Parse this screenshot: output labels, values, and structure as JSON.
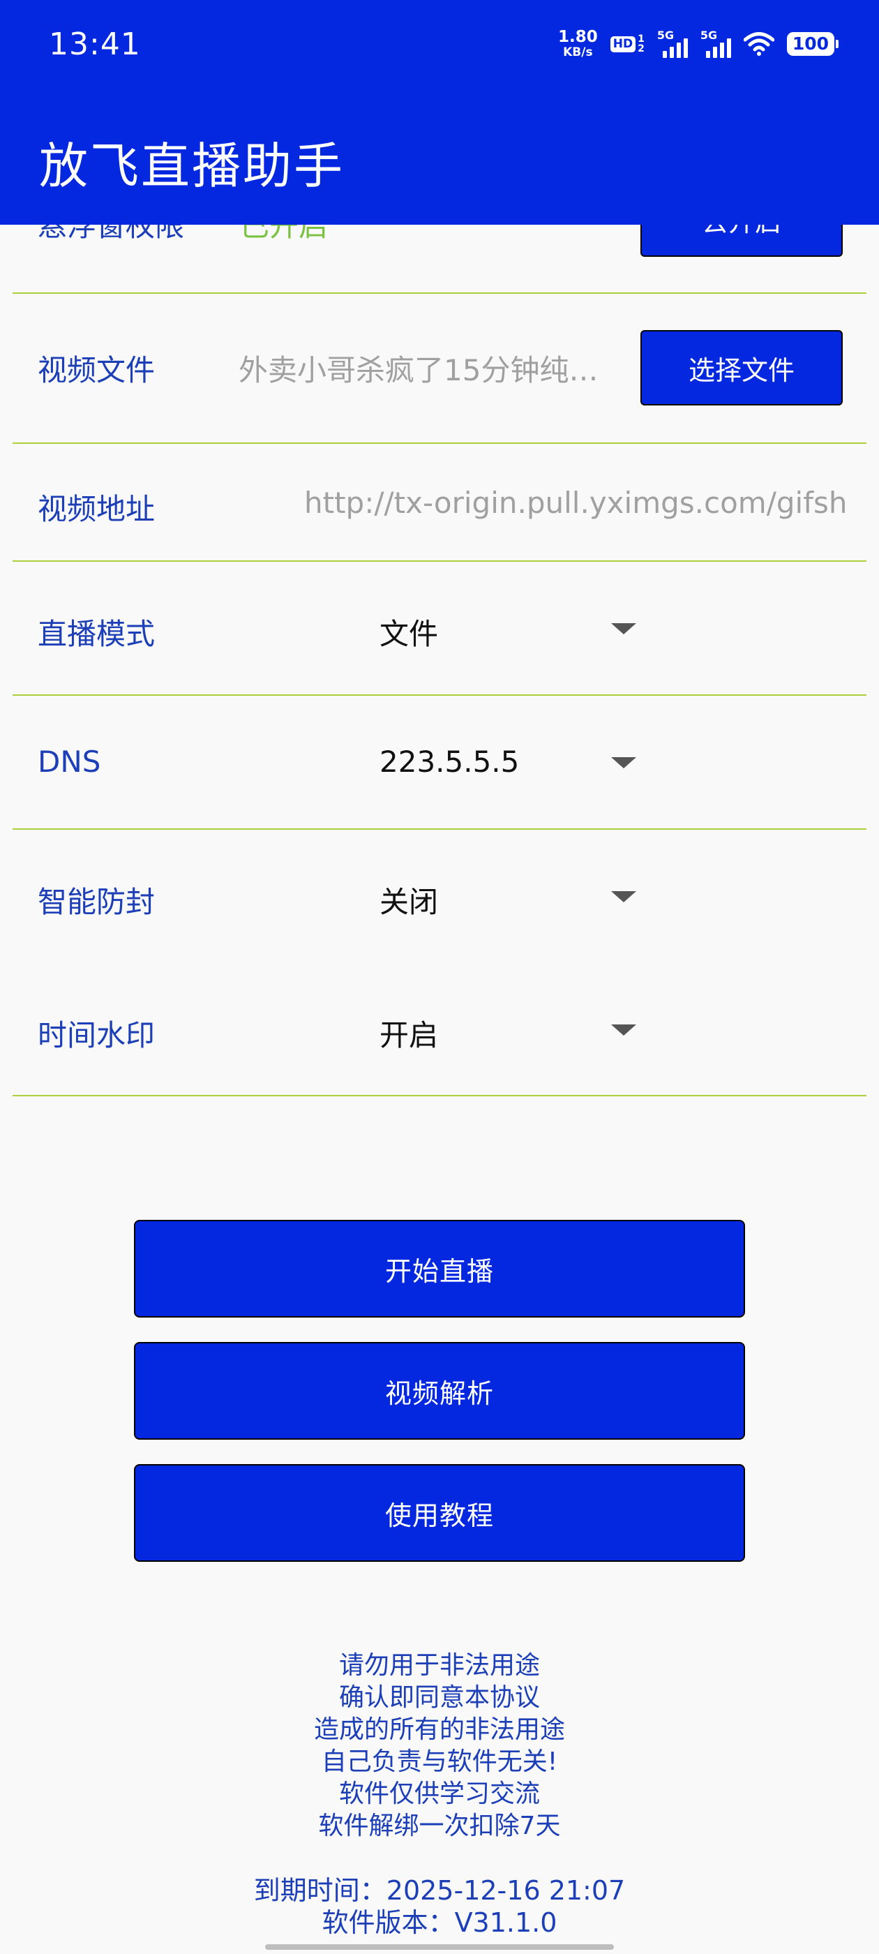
{
  "status_bar": {
    "time": "13:41",
    "net_speed_value": "1.80",
    "net_speed_unit": "KB/s",
    "hd_label": "HD",
    "hd_sub_top": "1",
    "hd_sub_bottom": "2",
    "signal1_label": "5G",
    "signal2_label": "5G",
    "battery": "100"
  },
  "app_bar": {
    "title": "放飞直播助手"
  },
  "rows": {
    "permission": {
      "label": "悬浮窗权限",
      "status": "已开启",
      "button_label": "去开启"
    },
    "video_file": {
      "label": "视频文件",
      "value": "外卖小哥杀疯了15分钟纯…",
      "button_label": "选择文件"
    },
    "video_url": {
      "label": "视频地址",
      "value": "http://tx-origin.pull.yximgs.com/gifsh"
    },
    "live_mode": {
      "label": "直播模式",
      "value": "文件"
    },
    "dns": {
      "label": "DNS",
      "value": "223.5.5.5"
    },
    "anti_ban": {
      "label": "智能防封",
      "value": "关闭"
    },
    "time_watermark": {
      "label": "时间水印",
      "value": "开启"
    }
  },
  "actions": {
    "start_live": "开始直播",
    "video_parse": "视频解析",
    "tutorial": "使用教程"
  },
  "notice_lines": [
    "请勿用于非法用途",
    "确认即同意本协议",
    "造成的所有的非法用途",
    "自己负责与软件无关!",
    "软件仅供学习交流",
    "软件解绑一次扣除7天"
  ],
  "meta": {
    "expiry": "到期时间：2025-12-16 21:07",
    "version": "软件版本：V31.1.0"
  },
  "colors": {
    "primary": "#0428e0",
    "label": "#1c3fb8",
    "divider": "#a9cf3a",
    "enabled_green": "#7cc242",
    "hint_gray": "#a0a0a0"
  }
}
